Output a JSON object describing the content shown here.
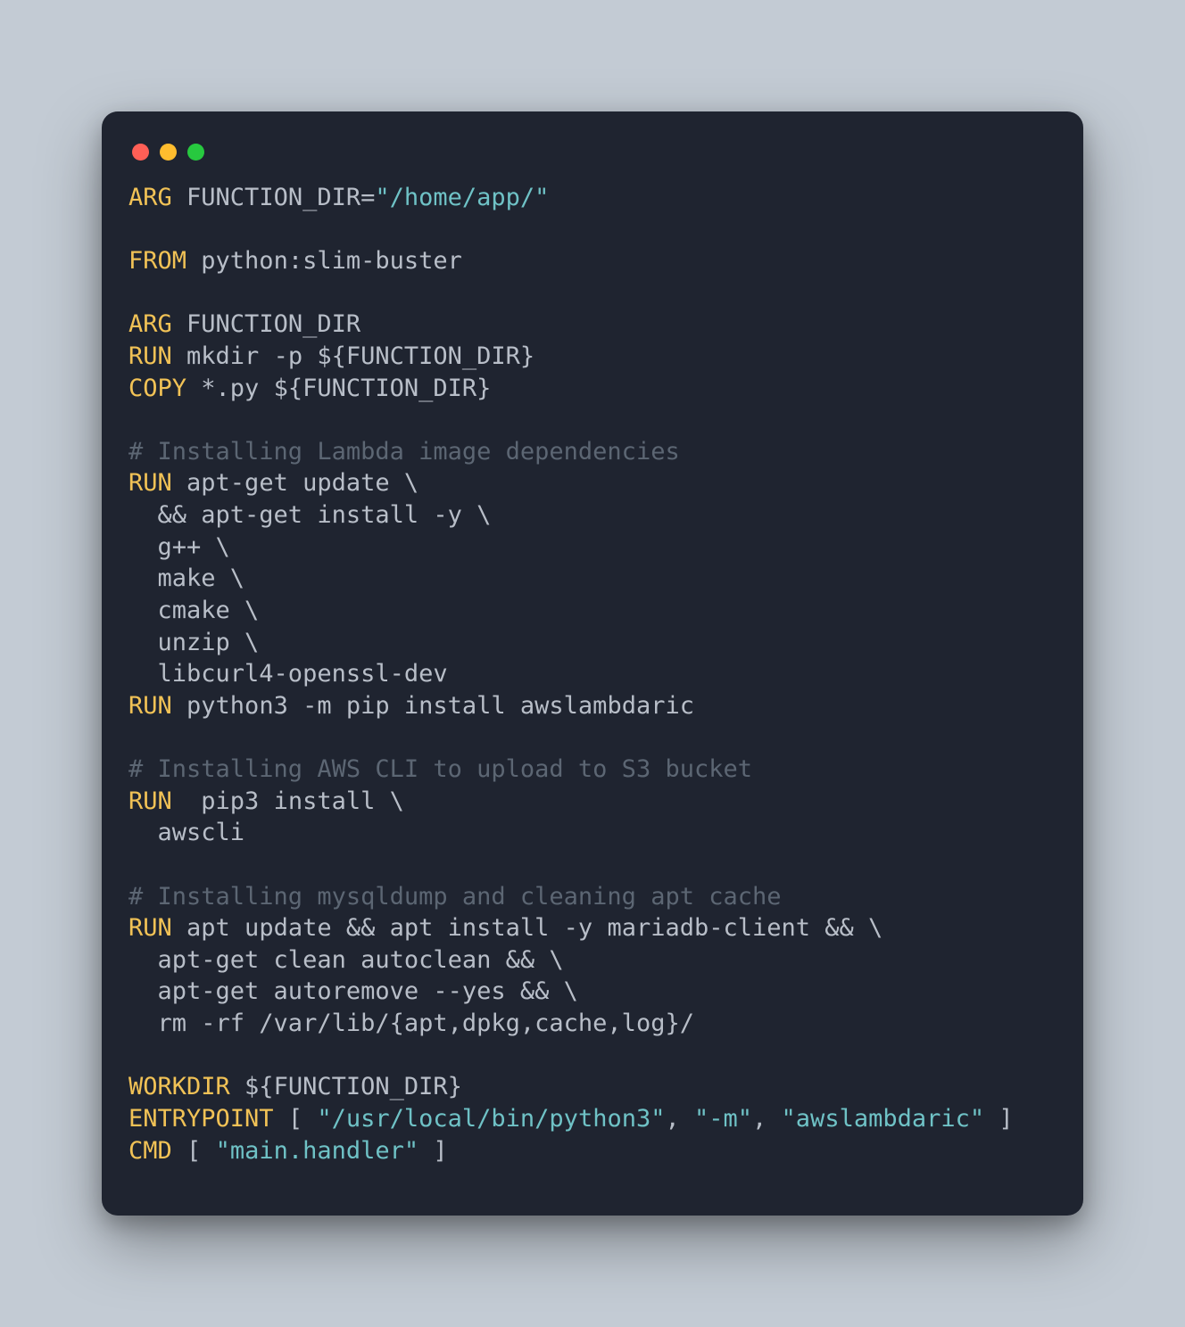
{
  "tokens": [
    {
      "c": "kw",
      "t": "ARG"
    },
    {
      "c": "txt",
      "t": " FUNCTION_DIR="
    },
    {
      "c": "str",
      "t": "\"/home/app/\""
    },
    {
      "c": "txt",
      "t": "\n"
    },
    {
      "c": "txt",
      "t": "\n"
    },
    {
      "c": "kw",
      "t": "FROM"
    },
    {
      "c": "txt",
      "t": " python:slim-buster\n"
    },
    {
      "c": "txt",
      "t": "\n"
    },
    {
      "c": "kw",
      "t": "ARG"
    },
    {
      "c": "txt",
      "t": " FUNCTION_DIR\n"
    },
    {
      "c": "kw",
      "t": "RUN"
    },
    {
      "c": "txt",
      "t": " mkdir -p ${FUNCTION_DIR}\n"
    },
    {
      "c": "kw",
      "t": "COPY"
    },
    {
      "c": "txt",
      "t": " *.py ${FUNCTION_DIR}\n"
    },
    {
      "c": "txt",
      "t": "\n"
    },
    {
      "c": "cm",
      "t": "# Installing Lambda image dependencies"
    },
    {
      "c": "txt",
      "t": "\n"
    },
    {
      "c": "kw",
      "t": "RUN"
    },
    {
      "c": "txt",
      "t": " apt-get update \\\n"
    },
    {
      "c": "txt",
      "t": "  && apt-get install -y \\\n"
    },
    {
      "c": "txt",
      "t": "  g++ \\\n"
    },
    {
      "c": "txt",
      "t": "  make \\\n"
    },
    {
      "c": "txt",
      "t": "  cmake \\\n"
    },
    {
      "c": "txt",
      "t": "  unzip \\\n"
    },
    {
      "c": "txt",
      "t": "  libcurl4-openssl-dev\n"
    },
    {
      "c": "kw",
      "t": "RUN"
    },
    {
      "c": "txt",
      "t": " python3 -m pip install awslambdaric\n"
    },
    {
      "c": "txt",
      "t": "\n"
    },
    {
      "c": "cm",
      "t": "# Installing AWS CLI to upload to S3 bucket"
    },
    {
      "c": "txt",
      "t": "\n"
    },
    {
      "c": "kw",
      "t": "RUN"
    },
    {
      "c": "txt",
      "t": "  pip3 install \\\n"
    },
    {
      "c": "txt",
      "t": "  awscli\n"
    },
    {
      "c": "txt",
      "t": "\n"
    },
    {
      "c": "cm",
      "t": "# Installing mysqldump and cleaning apt cache"
    },
    {
      "c": "txt",
      "t": "\n"
    },
    {
      "c": "kw",
      "t": "RUN"
    },
    {
      "c": "txt",
      "t": " apt update && apt install -y mariadb-client && \\\n"
    },
    {
      "c": "txt",
      "t": "  apt-get clean autoclean && \\\n"
    },
    {
      "c": "txt",
      "t": "  apt-get autoremove --yes && \\\n"
    },
    {
      "c": "txt",
      "t": "  rm -rf /var/lib/{apt,dpkg,cache,log}/\n"
    },
    {
      "c": "txt",
      "t": "\n"
    },
    {
      "c": "kw",
      "t": "WORKDIR"
    },
    {
      "c": "txt",
      "t": " ${FUNCTION_DIR}\n"
    },
    {
      "c": "kw",
      "t": "ENTRYPOINT"
    },
    {
      "c": "txt",
      "t": " [ "
    },
    {
      "c": "str",
      "t": "\"/usr/local/bin/python3\""
    },
    {
      "c": "txt",
      "t": ", "
    },
    {
      "c": "str",
      "t": "\"-m\""
    },
    {
      "c": "txt",
      "t": ", "
    },
    {
      "c": "str",
      "t": "\"awslambdaric\""
    },
    {
      "c": "txt",
      "t": " ]\n"
    },
    {
      "c": "kw",
      "t": "CMD"
    },
    {
      "c": "txt",
      "t": " [ "
    },
    {
      "c": "str",
      "t": "\"main.handler\""
    },
    {
      "c": "txt",
      "t": " ]"
    }
  ]
}
